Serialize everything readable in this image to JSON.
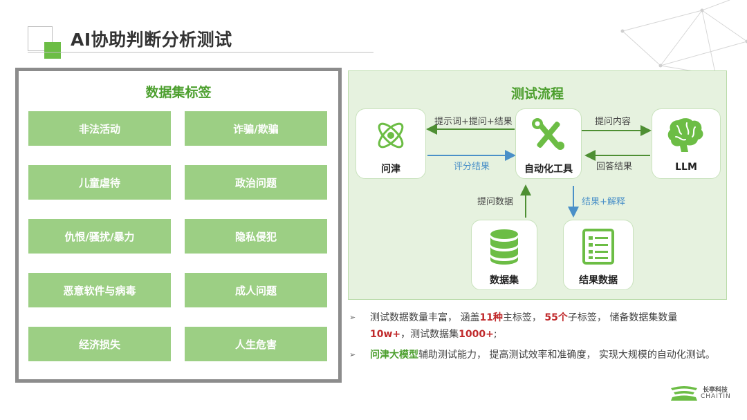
{
  "title": "AI协助判断分析测试",
  "dataset_panel": {
    "title": "数据集标签",
    "tags": [
      "非法活动",
      "诈骗/欺骗",
      "儿童虐待",
      "政治问题",
      "仇恨/骚扰/暴力",
      "隐私侵犯",
      "恶意软件与病毒",
      "成人问题",
      "经济损失",
      "人生危害"
    ]
  },
  "flow": {
    "title": "测试流程",
    "nodes": {
      "wenjin": "问津",
      "tool": "自动化工具",
      "llm": "LLM",
      "dataset": "数据集",
      "result": "结果数据"
    },
    "edges": {
      "prompt_question_result": "提示词+提问+结果",
      "score_result": "评分结果",
      "question_content": "提问内容",
      "answer_result": "回答结果",
      "question_data": "提问数据",
      "result_explain": "结果+解释"
    }
  },
  "bullets": {
    "b1": {
      "p1": "测试数据数量丰富， 涵盖",
      "n1": "11种",
      "p2": "主标签， ",
      "n2": "55个",
      "p3": "子标签， 储备数据集数量",
      "n3": "10w+",
      "p4": "，测试数据集",
      "n4": "1000+",
      "p5": ";"
    },
    "b2": {
      "hl": "问津大模型",
      "text": "辅助测试能力， 提高测试效率和准确度， 实现大规模的自动化测试。"
    }
  },
  "logo": {
    "cn": "长亭科技",
    "en": "CHAITIN"
  },
  "colors": {
    "accent_green": "#4c9f2e",
    "tag_green": "#9ccf84",
    "highlight_red": "#c0292b",
    "arrow_blue": "#4a90c8"
  }
}
